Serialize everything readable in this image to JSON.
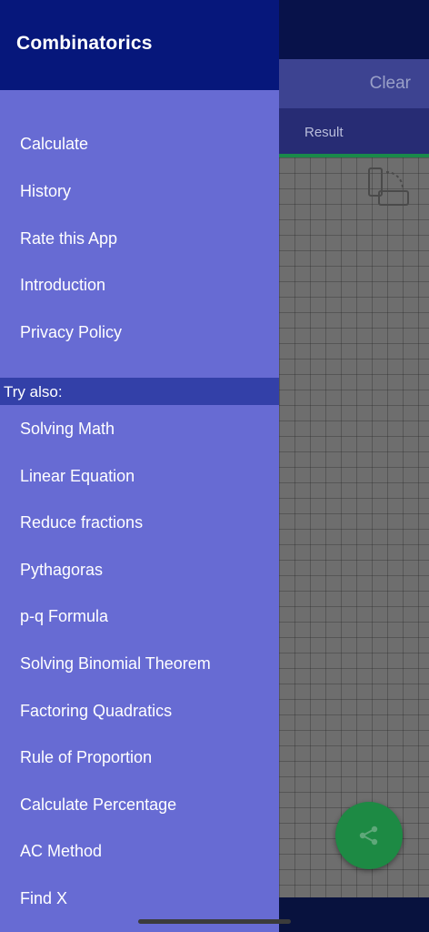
{
  "background": {
    "clear_label": "Clear",
    "result_tab_label": "Result",
    "rotate_icon": "rotate-screen-icon",
    "share_icon": "share-icon"
  },
  "drawer": {
    "title": "Combinatorics",
    "menu": [
      {
        "label": "Calculate"
      },
      {
        "label": "History"
      },
      {
        "label": "Rate this App"
      },
      {
        "label": "Introduction"
      },
      {
        "label": "Privacy Policy"
      }
    ],
    "try_also_label": "Try also:",
    "try_also": [
      {
        "label": "Solving Math"
      },
      {
        "label": "Linear Equation"
      },
      {
        "label": "Reduce fractions"
      },
      {
        "label": "Pythagoras"
      },
      {
        "label": "p-q Formula"
      },
      {
        "label": "Solving Binomial Theorem"
      },
      {
        "label": "Factoring Quadratics"
      },
      {
        "label": "Rule of Proportion"
      },
      {
        "label": "Calculate Percentage"
      },
      {
        "label": "AC Method"
      },
      {
        "label": "Find X"
      }
    ]
  },
  "colors": {
    "drawer_bg": "#676bd3",
    "header_bg": "#06177b",
    "section_band": "#3340a8",
    "fab": "#1d8a44"
  }
}
